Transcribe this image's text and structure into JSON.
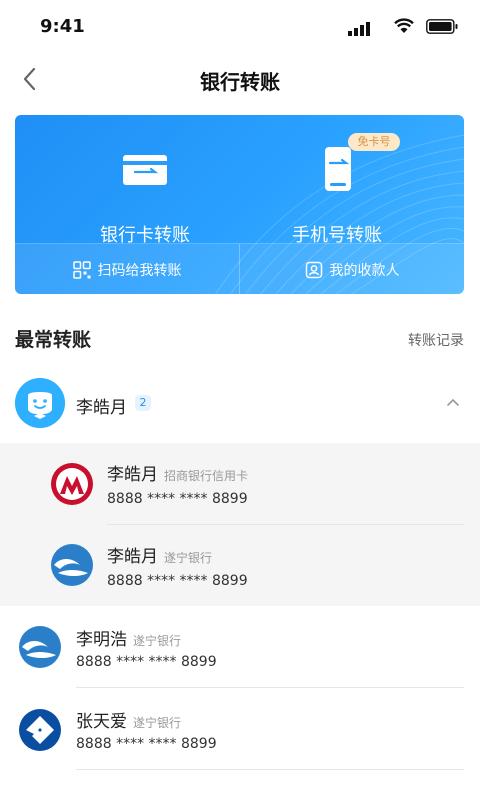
{
  "status_bar": {
    "time": "9:41"
  },
  "nav": {
    "title": "银行转账"
  },
  "card": {
    "bank_card_transfer": "银行卡转账",
    "phone_transfer": "手机号转账",
    "no_card_badge": "免卡号",
    "scan_transfer": "扫码给我转账",
    "my_payees": "我的收款人"
  },
  "section": {
    "title": "最常转账",
    "link": "转账记录"
  },
  "contact_group": {
    "name": "李皓月",
    "count": "2",
    "accounts": [
      {
        "name": "李皓月",
        "bank": "招商银行信用卡",
        "number": "8888 ****  **** 8899"
      },
      {
        "name": "李皓月",
        "bank": "遂宁银行",
        "number": "8888 ****  **** 8899"
      }
    ]
  },
  "contacts": [
    {
      "name": "李明浩",
      "bank": "遂宁银行",
      "number": "8888 ****  **** 8899"
    },
    {
      "name": "张天爱",
      "bank": "遂宁银行",
      "number": "8888 ****  **** 8899"
    }
  ],
  "colors": {
    "accent": "#2a9dfa",
    "badge_bg": "#fde8c8",
    "badge_text": "#d79248"
  }
}
